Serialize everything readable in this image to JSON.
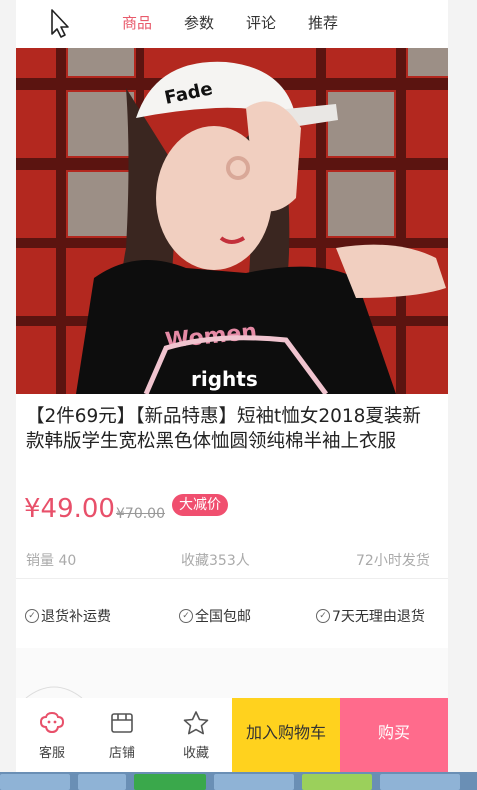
{
  "tabs": [
    {
      "label": "商品"
    },
    {
      "label": "参数"
    },
    {
      "label": "评论"
    },
    {
      "label": "推荐"
    }
  ],
  "product": {
    "title": "【2件69元】【新品特惠】短袖t恤女2018夏装新款韩版学生宽松黑色体恤圆领纯棉半袖上衣服",
    "price": "¥49.00",
    "old_price": "¥70.00",
    "badge": "大减价",
    "sales": "销量 40",
    "favorites": "收藏353人",
    "shipping": "72小时发货",
    "shirt_print_1": "Women",
    "shirt_print_2": "rights"
  },
  "guarantees": [
    "退货补运费",
    "全国包邮",
    "7天无理由退货"
  ],
  "bottom": {
    "service": "客服",
    "shop": "店铺",
    "favorite": "收藏",
    "add_cart": "加入购物车",
    "buy": "购买"
  },
  "colors": {
    "accent": "#e8506a",
    "cart": "#ffd21e",
    "buy": "#ff6b8c"
  }
}
